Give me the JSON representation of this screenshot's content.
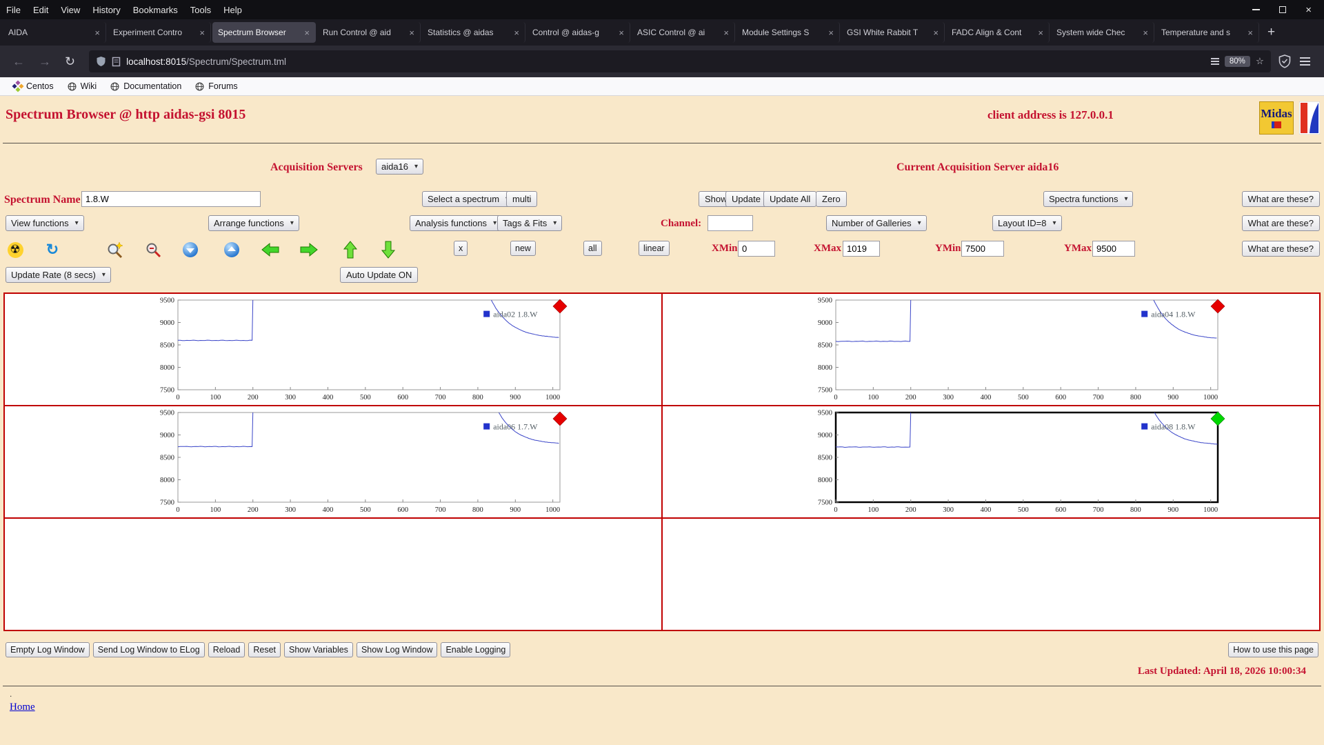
{
  "colors": {
    "accent_red": "#c41230",
    "gallery_border": "#c00000",
    "page_background": "#f9e8c9",
    "trace_blue": "#3a45c8",
    "marker_red": "#e60000",
    "marker_green": "#00d800"
  },
  "glyphs": {
    "close": "×",
    "plus": "+",
    "back": "←",
    "forward": "→",
    "reload": "↻",
    "star": "☆",
    "select_arrow": "▾",
    "radiation": "☢",
    "refresh": "↻"
  },
  "window": {
    "menu": [
      "File",
      "Edit",
      "View",
      "History",
      "Bookmarks",
      "Tools",
      "Help"
    ]
  },
  "tabs": [
    {
      "label": "AIDA"
    },
    {
      "label": "Experiment Contro"
    },
    {
      "label": "Spectrum Browser",
      "active": true
    },
    {
      "label": "Run Control @ aid"
    },
    {
      "label": "Statistics @ aidas"
    },
    {
      "label": "Control @ aidas-g"
    },
    {
      "label": "ASIC Control @ ai"
    },
    {
      "label": "Module Settings S"
    },
    {
      "label": "GSI White Rabbit T"
    },
    {
      "label": "FADC Align & Cont"
    },
    {
      "label": "System wide Chec"
    },
    {
      "label": "Temperature and s"
    }
  ],
  "navbar": {
    "url_host": "localhost:8015",
    "url_path": "/Spectrum/Spectrum.tml",
    "zoom": "80%"
  },
  "bookmarks": [
    "Centos",
    "Wiki",
    "Documentation",
    "Forums"
  ],
  "page": {
    "title": "Spectrum Browser @ http aidas-gsi 8015",
    "client_address": "client address is 127.0.0.1",
    "acquisition_servers_label": "Acquisition Servers",
    "acquisition_server_selected": "aida16",
    "current_server_text": "Current Acquisition Server aida16",
    "spectrum_name_label": "Spectrum Name:",
    "spectrum_name_value": "1.8.W",
    "select_spectrum_label": "Select a spectrum",
    "multi_button": "multi",
    "show_button": "Show",
    "update_button": "Update",
    "update_all_button": "Update All",
    "zero_button": "Zero",
    "spectra_functions_label": "Spectra functions",
    "what_are_these_button": "What are these?",
    "view_functions_label": "View functions",
    "arrange_functions_label": "Arrange functions",
    "analysis_functions_label": "Analysis functions",
    "tags_fits_label": "Tags & Fits",
    "channel_label": "Channel:",
    "channel_value": "",
    "number_of_galleries_label": "Number of Galleries",
    "layout_id_label": "Layout ID=8",
    "x_button": "x",
    "new_button": "new",
    "all_button": "all",
    "linear_button": "linear",
    "xmin_label": "XMin",
    "xmin_value": "0",
    "xmax_label": "XMax",
    "xmax_value": "1019",
    "ymin_label": "YMin",
    "ymin_value": "7500",
    "ymax_label": "YMax",
    "ymax_value": "9500",
    "update_rate_label": "Update Rate (8 secs)",
    "auto_update_button": "Auto Update ON",
    "footer_buttons": [
      "Empty Log Window",
      "Send Log Window to ELog",
      "Reload",
      "Reset",
      "Show Variables",
      "Show Log Window",
      "Enable Logging"
    ],
    "how_to_button": "How to use this page",
    "last_updated": "Last Updated: April 18, 2026 10:00:34",
    "home_link": "Home",
    "dot": "."
  },
  "chart_data": [
    {
      "type": "line",
      "gallery_position": "top-left",
      "legend": "aida02 1.8.W",
      "series_color": "#3a45c8",
      "marker_color": "#e60000",
      "selected": false,
      "xlim": [
        0,
        1019
      ],
      "ylim": [
        7500,
        9500
      ],
      "x_ticks": [
        0,
        100,
        200,
        300,
        400,
        500,
        600,
        700,
        800,
        900,
        1000
      ],
      "y_ticks": [
        7500,
        8000,
        8500,
        9000,
        9500
      ],
      "baseline_y": 8600,
      "step_x": 200,
      "offscale_until_x": 836,
      "decay_tau": 52,
      "settle_y": 8640,
      "seed": 1
    },
    {
      "type": "line",
      "gallery_position": "top-right",
      "legend": "aida04 1.8.W",
      "series_color": "#3a45c8",
      "marker_color": "#e60000",
      "selected": false,
      "xlim": [
        0,
        1019
      ],
      "ylim": [
        7500,
        9500
      ],
      "x_ticks": [
        0,
        100,
        200,
        300,
        400,
        500,
        600,
        700,
        800,
        900,
        1000
      ],
      "y_ticks": [
        7500,
        8000,
        8500,
        9000,
        9500
      ],
      "baseline_y": 8580,
      "step_x": 200,
      "offscale_until_x": 848,
      "decay_tau": 50,
      "settle_y": 8620,
      "seed": 2
    },
    {
      "type": "line",
      "gallery_position": "middle-left",
      "legend": "aida06 1.7.W",
      "series_color": "#3a45c8",
      "marker_color": "#e60000",
      "selected": false,
      "xlim": [
        0,
        1019
      ],
      "ylim": [
        7500,
        9500
      ],
      "x_ticks": [
        0,
        100,
        200,
        300,
        400,
        500,
        600,
        700,
        800,
        900,
        1000
      ],
      "y_ticks": [
        7500,
        8000,
        8500,
        9000,
        9500
      ],
      "baseline_y": 8740,
      "step_x": 200,
      "offscale_until_x": 856,
      "decay_tau": 48,
      "settle_y": 8790,
      "seed": 3
    },
    {
      "type": "line",
      "gallery_position": "middle-right",
      "legend": "aida08 1.8.W",
      "series_color": "#3a45c8",
      "marker_color": "#00d800",
      "selected": true,
      "xlim": [
        0,
        1019
      ],
      "ylim": [
        7500,
        9500
      ],
      "x_ticks": [
        0,
        100,
        200,
        300,
        400,
        500,
        600,
        700,
        800,
        900,
        1000
      ],
      "y_ticks": [
        7500,
        8000,
        8500,
        9000,
        9500
      ],
      "baseline_y": 8730,
      "step_x": 200,
      "offscale_until_x": 850,
      "decay_tau": 50,
      "settle_y": 8770,
      "seed": 4
    }
  ]
}
